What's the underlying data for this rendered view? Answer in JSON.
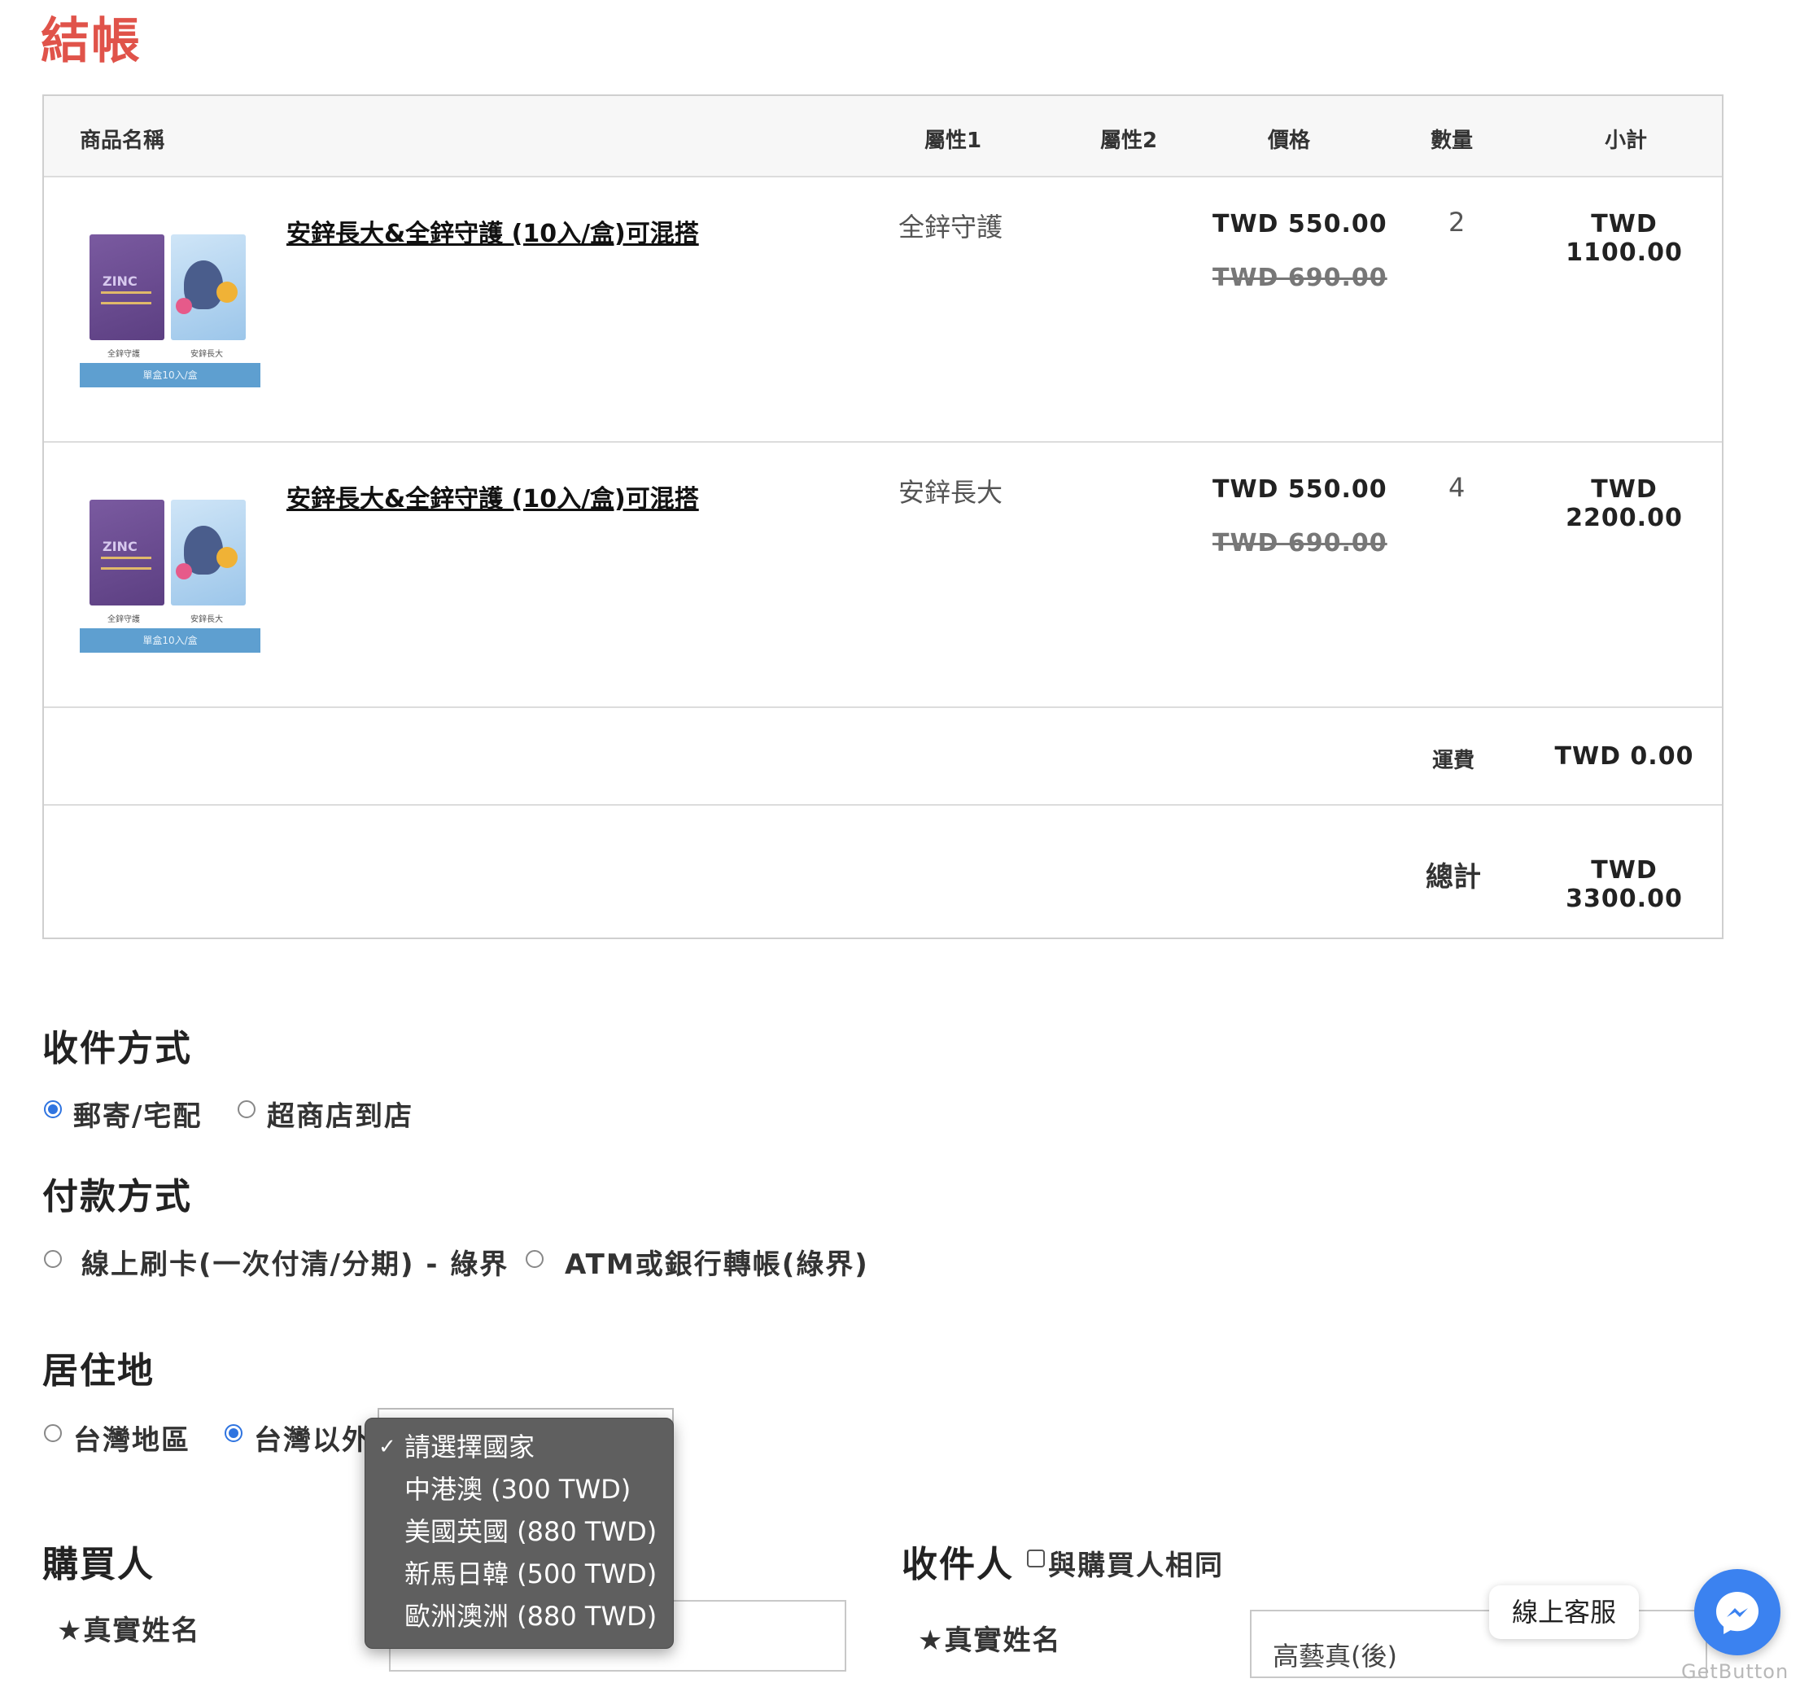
{
  "page": {
    "title": "結帳"
  },
  "cart": {
    "headers": [
      "商品名稱",
      "屬性1",
      "屬性2",
      "價格",
      "數量",
      "小計"
    ],
    "items": [
      {
        "name": "安鋅長大&全鋅守護 (10入/盒)可混搭",
        "attr1": "全鋅守護",
        "attr2": "",
        "price": "TWD 550.00",
        "old_price": "TWD 690.00",
        "qty": "2",
        "subtotal": "TWD 1100.00"
      },
      {
        "name": "安鋅長大&全鋅守護 (10入/盒)可混搭",
        "attr1": "安鋅長大",
        "attr2": "",
        "price": "TWD 550.00",
        "old_price": "TWD 690.00",
        "qty": "4",
        "subtotal": "TWD 2200.00"
      }
    ],
    "image_text": {
      "zinc": "ZINC",
      "left_caption": "全鋅守護",
      "right_caption": "安鋅長大",
      "banner": "單盒10入/盒"
    },
    "shipping_label": "運費",
    "shipping_value": "TWD 0.00",
    "total_label": "總計",
    "total_value": "TWD 3300.00"
  },
  "delivery": {
    "heading": "收件方式",
    "options": [
      "郵寄/宅配",
      "超商店到店"
    ],
    "selected": "郵寄/宅配"
  },
  "payment": {
    "heading": "付款方式",
    "options": [
      "線上刷卡(一次付清/分期) - 綠界",
      "ATM或銀行轉帳(綠界)"
    ],
    "selected": ""
  },
  "residence": {
    "heading": "居住地",
    "options": [
      "台灣地區",
      "台灣以外"
    ],
    "selected": "台灣以外",
    "country_options": [
      "請選擇國家",
      "中港澳 (300 TWD)",
      "美國英國 (880 TWD)",
      "新馬日韓 (500 TWD)",
      "歐洲澳洲 (880 TWD)"
    ],
    "country_selected": "請選擇國家"
  },
  "buyer": {
    "heading": "購買人",
    "name_label": "★真實姓名"
  },
  "recipient": {
    "heading": "收件人",
    "same_as_buyer_label": "與購買人相同",
    "name_label": "★真實姓名",
    "name_value": "高藝真(後)"
  },
  "chat": {
    "label": "線上客服",
    "brand": "GetButton"
  },
  "colors": {
    "accent": "#e0534a",
    "radio": "#2f74e0",
    "messenger": "#3b82f0"
  }
}
